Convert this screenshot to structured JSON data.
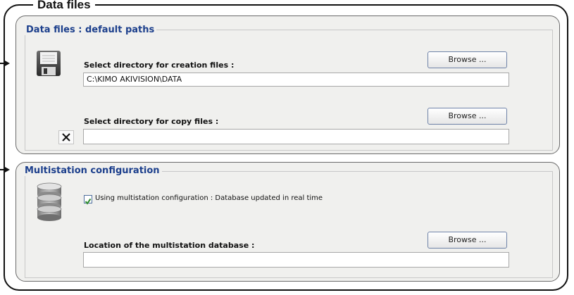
{
  "outer": {
    "title": "Data files"
  },
  "data_files": {
    "legend": "Data files : default paths",
    "creation_label": "Select directory for creation files :",
    "creation_value": "C:\\KIMO AKIVISION\\DATA",
    "creation_browse": "Browse ...",
    "copy_label": "Select directory for copy files :",
    "copy_value": "",
    "copy_browse": "Browse ...",
    "icons": {
      "save": "floppy-disk-icon",
      "clear": "close-icon"
    }
  },
  "multistation": {
    "legend": "Multistation configuration",
    "checkbox_label": "Using multistation configuration : Database updated in real time",
    "checkbox_checked": true,
    "location_label": "Location of the multistation database :",
    "location_value": "",
    "location_browse": "Browse ...",
    "icons": {
      "database": "database-icon"
    }
  },
  "colors": {
    "legend_blue": "#1c3f8c",
    "check_green": "#2e8b2e"
  }
}
